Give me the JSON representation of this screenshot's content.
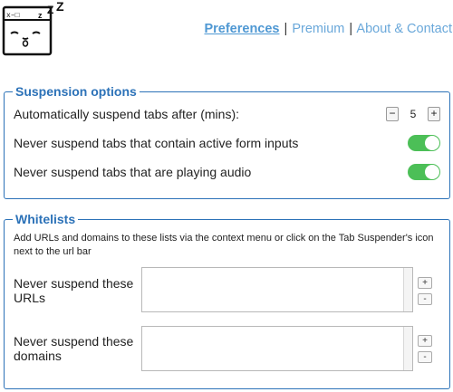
{
  "header": {
    "logo_icon": "sleeping-tab-icon",
    "logo_tab_text": "x–□",
    "logo_zzz": "z Z Z",
    "nav": {
      "preferences": "Preferences",
      "premium": "Premium",
      "about": "About & Contact",
      "separator": "|"
    }
  },
  "suspension": {
    "legend": "Suspension options",
    "auto_suspend_label": "Automatically suspend tabs after (mins):",
    "stepper": {
      "minus": "−",
      "value": "5",
      "plus": "+"
    },
    "form_inputs_label": "Never suspend tabs that contain active form inputs",
    "form_inputs_enabled": true,
    "audio_label": "Never suspend tabs that are playing audio",
    "audio_enabled": true
  },
  "whitelists": {
    "legend": "Whitelists",
    "description": "Add URLs and domains to these lists via the context menu or click on the Tab Suspender's icon next to the url bar",
    "urls_label": "Never suspend these URLs",
    "domains_label": "Never suspend these domains",
    "add_label": "+",
    "remove_label": "-"
  },
  "colors": {
    "accent": "#2c72b8",
    "link": "#6aa8da",
    "toggle_on": "#4cbf57"
  }
}
